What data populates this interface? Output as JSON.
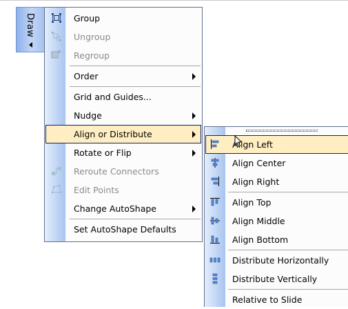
{
  "toolbar": {
    "title": "Draw"
  },
  "main_menu": {
    "items": [
      {
        "label": "Group",
        "enabled": true,
        "icon": "group-icon"
      },
      {
        "label": "Ungroup",
        "enabled": false,
        "icon": "ungroup-icon"
      },
      {
        "label": "Regroup",
        "enabled": false,
        "icon": "regroup-icon"
      },
      {
        "label": "Order",
        "enabled": true,
        "submenu": true
      },
      {
        "label": "Grid and Guides...",
        "enabled": true
      },
      {
        "label": "Nudge",
        "enabled": true,
        "submenu": true
      },
      {
        "label": "Align or Distribute",
        "enabled": true,
        "submenu": true,
        "highlighted": true
      },
      {
        "label": "Rotate or Flip",
        "enabled": true,
        "submenu": true
      },
      {
        "label": "Reroute Connectors",
        "enabled": false,
        "icon": "reroute-connectors-icon"
      },
      {
        "label": "Edit Points",
        "enabled": false,
        "icon": "edit-points-icon"
      },
      {
        "label": "Change AutoShape",
        "enabled": true,
        "submenu": true
      },
      {
        "label": "Set AutoShape Defaults",
        "enabled": true
      }
    ]
  },
  "sub_menu": {
    "items": [
      {
        "label": "Align Left",
        "highlighted": true,
        "icon": "align-left-icon"
      },
      {
        "label": "Align Center",
        "icon": "align-center-icon"
      },
      {
        "label": "Align Right",
        "icon": "align-right-icon"
      },
      {
        "label": "Align Top",
        "icon": "align-top-icon"
      },
      {
        "label": "Align Middle",
        "icon": "align-middle-icon"
      },
      {
        "label": "Align Bottom",
        "icon": "align-bottom-icon"
      },
      {
        "label": "Distribute Horizontally",
        "icon": "distribute-horizontally-icon"
      },
      {
        "label": "Distribute Vertically",
        "icon": "distribute-vertically-icon"
      },
      {
        "label": "Relative to Slide"
      }
    ]
  },
  "colors": {
    "highlight_bg": "#ffeec2",
    "highlight_border": "#0a246a",
    "gutter_light": "#e4eefc",
    "gutter_dark": "#a8c4ef",
    "disabled_text": "#8a8a8a"
  }
}
